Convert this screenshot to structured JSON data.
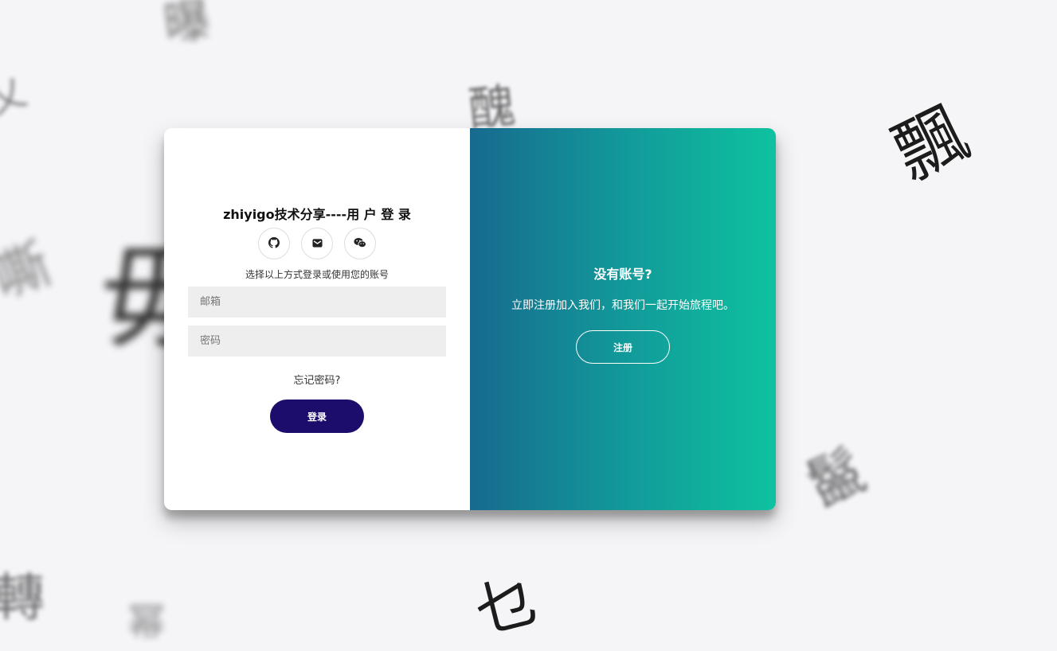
{
  "background": {
    "glyphs": [
      "曝",
      "乂",
      "醜",
      "飄",
      "嘶",
      "毋",
      "鬣",
      "乜",
      "轉",
      "幂"
    ]
  },
  "login": {
    "title": "zhiyigo技术分享----用 户 登 录",
    "social_icons": [
      "github-icon",
      "mail-icon",
      "wechat-icon"
    ],
    "hint": "选择以上方式登录或使用您的账号",
    "email_placeholder": "邮箱",
    "password_placeholder": "密码",
    "forgot": "忘记密码?",
    "submit": "登录"
  },
  "register_panel": {
    "title": "没有账号?",
    "text": "立即注册加入我们，和我们一起开始旅程吧。",
    "button": "注册"
  },
  "colors": {
    "page_bg": "#f5f5f7",
    "login_button": "#1c0c6b",
    "gradient_start": "#176a8e",
    "gradient_end": "#0ec29f"
  }
}
